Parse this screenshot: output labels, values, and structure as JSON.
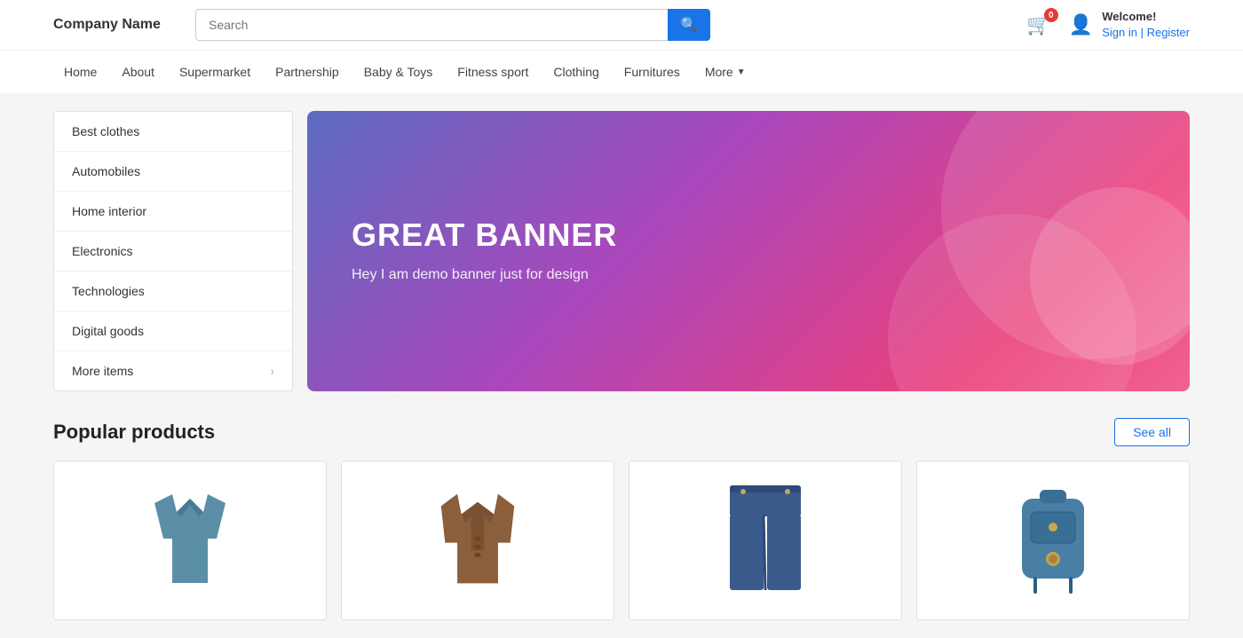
{
  "header": {
    "logo": "Company Name",
    "search_placeholder": "Search",
    "cart_count": "0",
    "welcome_text": "Welcome!",
    "signin_text": "Sign in | Register"
  },
  "navbar": {
    "items": [
      {
        "label": "Home",
        "has_dropdown": false
      },
      {
        "label": "About",
        "has_dropdown": false
      },
      {
        "label": "Supermarket",
        "has_dropdown": false
      },
      {
        "label": "Partnership",
        "has_dropdown": false
      },
      {
        "label": "Baby &amp; Toys",
        "has_dropdown": false
      },
      {
        "label": "Fitness sport",
        "has_dropdown": false
      },
      {
        "label": "Clothing",
        "has_dropdown": false
      },
      {
        "label": "Furnitures",
        "has_dropdown": false
      },
      {
        "label": "More",
        "has_dropdown": true
      }
    ]
  },
  "sidebar": {
    "categories": [
      {
        "label": "Best clothes",
        "has_arrow": false
      },
      {
        "label": "Automobiles",
        "has_arrow": false
      },
      {
        "label": "Home interior",
        "has_arrow": false
      },
      {
        "label": "Electronics",
        "has_arrow": false
      },
      {
        "label": "Technologies",
        "has_arrow": false
      },
      {
        "label": "Digital goods",
        "has_arrow": false
      },
      {
        "label": "More items",
        "has_arrow": true
      }
    ]
  },
  "banner": {
    "title": "GREAT BANNER",
    "subtitle": "Hey I am demo banner just\nfor design"
  },
  "popular_products": {
    "title": "Popular products",
    "see_all_label": "See all",
    "products": [
      {
        "type": "shirt",
        "color": "#5b8fa8"
      },
      {
        "type": "jacket",
        "color": "#8B5E3C"
      },
      {
        "type": "jeans",
        "color": "#3a5a8c"
      },
      {
        "type": "backpack",
        "color": "#4a7fa5"
      }
    ]
  }
}
